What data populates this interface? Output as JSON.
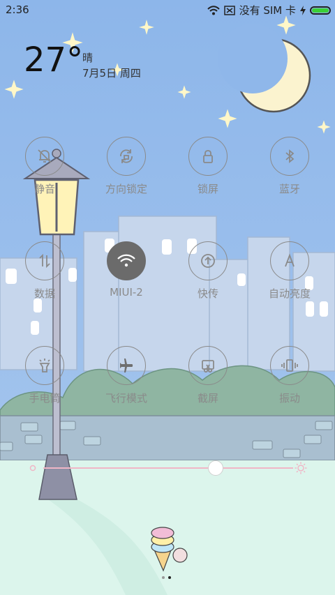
{
  "status_bar": {
    "time": "2:36",
    "no_sim_text": "没有 SIM 卡",
    "battery_level": 1.0,
    "battery_color": "#3bcf36"
  },
  "weather": {
    "temperature": "27°",
    "condition": "晴",
    "date": "7月5日 周四"
  },
  "toggles": [
    {
      "label": "静音",
      "icon": "bell-muted-icon",
      "active": false
    },
    {
      "label": "方向锁定",
      "icon": "rotation-lock-icon",
      "active": false
    },
    {
      "label": "锁屏",
      "icon": "lock-icon",
      "active": false
    },
    {
      "label": "蓝牙",
      "icon": "bluetooth-icon",
      "active": false
    },
    {
      "label": "数据",
      "icon": "mobile-data-icon",
      "active": false
    },
    {
      "label": "MIUI-2",
      "icon": "wifi-icon",
      "active": true
    },
    {
      "label": "快传",
      "icon": "share-transfer-icon",
      "active": false
    },
    {
      "label": "自动亮度",
      "icon": "auto-brightness-icon",
      "active": false
    },
    {
      "label": "手电筒",
      "icon": "flashlight-icon",
      "active": false
    },
    {
      "label": "飞行模式",
      "icon": "airplane-icon",
      "active": false
    },
    {
      "label": "截屏",
      "icon": "screenshot-icon",
      "active": false
    },
    {
      "label": "振动",
      "icon": "vibrate-icon",
      "active": false
    }
  ],
  "brightness": {
    "level": 0.69
  },
  "page_indicator": {
    "count": 2,
    "current": 2
  },
  "colors": {
    "sky": "#8eb8ea",
    "ground": "#dcf5ec",
    "active_toggle": "#6b6b6b",
    "accent_pink": "#f0b6c6"
  }
}
